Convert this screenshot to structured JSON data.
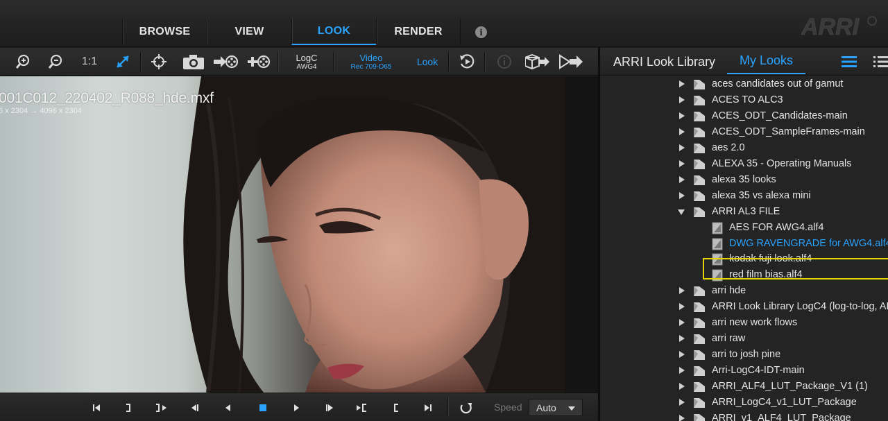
{
  "nav": {
    "tabs": [
      {
        "label": "BROWSE",
        "active": false
      },
      {
        "label": "VIEW",
        "active": false
      },
      {
        "label": "LOOK",
        "active": true
      },
      {
        "label": "RENDER",
        "active": false
      }
    ],
    "info_icon": "info-icon",
    "logo_text": "ARRI"
  },
  "toolbar": {
    "zoom_in_icon": "zoom-in-icon",
    "zoom_out_icon": "zoom-out-icon",
    "one_to_one": "1:1",
    "fit_icon": "fit-diagonal-icon",
    "crosshair_icon": "crosshair-icon",
    "snapshot_icon": "camera-icon",
    "input": {
      "line1": "LogC",
      "line2": "AWG4"
    },
    "output": {
      "line1": "Video",
      "line2": "Rec 709-D65"
    },
    "look": "Look",
    "accent_color": "#2aa3ff"
  },
  "viewer": {
    "clip_name": "001C012_220402_R088_hde.mxf",
    "clip_resolution": "6 x 2304  →  4096 x 2304"
  },
  "transport": {
    "speed_label": "Speed",
    "speed_value": "Auto"
  },
  "library": {
    "tab_library": "ARRI Look Library",
    "tab_my_looks": "My Looks",
    "items": [
      {
        "label": "aces candidates out of gamut",
        "type": "folder",
        "expanded": false,
        "depth": 0
      },
      {
        "label": "ACES TO ALC3",
        "type": "folder",
        "expanded": false,
        "depth": 0
      },
      {
        "label": "ACES_ODT_Candidates-main",
        "type": "folder",
        "expanded": false,
        "depth": 0
      },
      {
        "label": "ACES_ODT_SampleFrames-main",
        "type": "folder",
        "expanded": false,
        "depth": 0
      },
      {
        "label": "aes 2.0",
        "type": "folder",
        "expanded": false,
        "depth": 0
      },
      {
        "label": "ALEXA 35 - Operating Manuals",
        "type": "folder",
        "expanded": false,
        "depth": 0
      },
      {
        "label": "alexa 35 looks",
        "type": "folder",
        "expanded": false,
        "depth": 0
      },
      {
        "label": "alexa 35 vs alexa mini",
        "type": "folder",
        "expanded": false,
        "depth": 0
      },
      {
        "label": "ARRI AL3 FILE",
        "type": "folder",
        "expanded": true,
        "depth": 0
      },
      {
        "label": "AES FOR  AWG4.alf4",
        "type": "file",
        "depth": 1
      },
      {
        "label": "DWG RAVENGRADE for AWG4.alf4",
        "type": "file",
        "depth": 1,
        "selected": true
      },
      {
        "label": "kodak fuji look.alf4",
        "type": "file",
        "depth": 1
      },
      {
        "label": "red film bias.alf4",
        "type": "file",
        "depth": 1
      },
      {
        "label": "arri hde",
        "type": "folder",
        "expanded": false,
        "depth": 0
      },
      {
        "label": "ARRI Look Library LogC4 (log-to-log, AL",
        "type": "folder",
        "expanded": false,
        "depth": 0
      },
      {
        "label": "arri new work flows",
        "type": "folder",
        "expanded": false,
        "depth": 0
      },
      {
        "label": "arri raw",
        "type": "folder",
        "expanded": false,
        "depth": 0
      },
      {
        "label": "arri to josh pine",
        "type": "folder",
        "expanded": false,
        "depth": 0
      },
      {
        "label": "Arri-LogC4-IDT-main",
        "type": "folder",
        "expanded": false,
        "depth": 0
      },
      {
        "label": "ARRI_ALF4_LUT_Package_V1 (1)",
        "type": "folder",
        "expanded": false,
        "depth": 0
      },
      {
        "label": "ARRI_LogC4_v1_LUT_Package",
        "type": "folder",
        "expanded": false,
        "depth": 0
      },
      {
        "label": "ARRI_v1_ALF4_LUT_Package",
        "type": "folder",
        "expanded": false,
        "depth": 0
      }
    ],
    "highlight_color": "#e3d400"
  }
}
